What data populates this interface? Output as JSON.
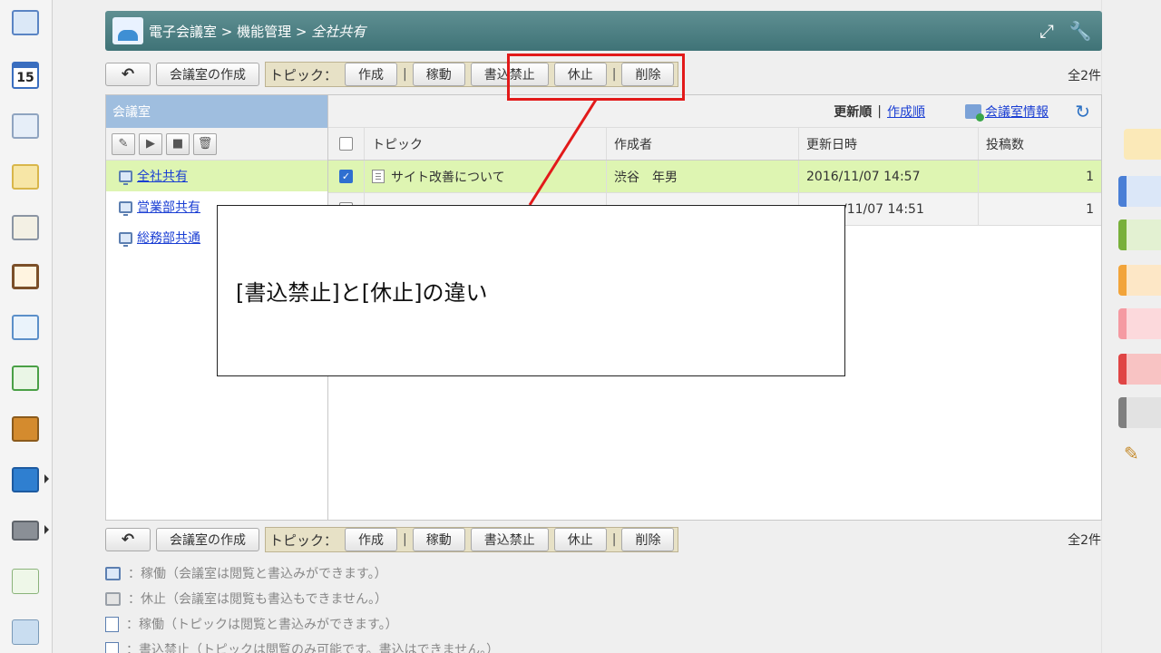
{
  "breadcrumb": {
    "root": "電子会議室",
    "sep1": " > ",
    "mid": "機能管理",
    "sep2": " > ",
    "current": "全社共有"
  },
  "toolbar": {
    "back_icon": "↶",
    "create_room": "会議室の作成",
    "topic_label": "トピック：",
    "create": "作成",
    "divider": "|",
    "activate": "稼動",
    "write_prohibit": "書込禁止",
    "suspend": "休止",
    "delete": "削除",
    "total": "全2件"
  },
  "rooms_panel": {
    "title": "会議室",
    "tools": [
      "edit-icon",
      "play-icon",
      "stop-icon",
      "trash-icon"
    ],
    "rooms": [
      {
        "name": "全社共有",
        "selected": true
      },
      {
        "name": "営業部共有",
        "selected": false
      },
      {
        "name": "総務部共通",
        "selected": false
      }
    ]
  },
  "sort": {
    "by_update": "更新順",
    "separator": "|",
    "by_create": "作成順",
    "room_info": "会議室情報"
  },
  "table": {
    "headers": [
      "トピック",
      "作成者",
      "更新日時",
      "投稿数"
    ],
    "rows": [
      {
        "topic": "サイト改善について",
        "author": "渋谷　年男",
        "updated": "2016/11/07 14:57",
        "posts": "1",
        "checked": true
      },
      {
        "topic": "",
        "author": "",
        "updated": "/11/07 14:51",
        "posts": "1",
        "checked": false
      }
    ]
  },
  "callout": {
    "text": "[書込禁止]と[休止]の違い"
  },
  "legend": [
    {
      "icon": "room-active-icon",
      "text": "：稼働（会議室は閲覧と書込みができます。）"
    },
    {
      "icon": "room-suspended-icon",
      "text": "：休止（会議室は閲覧も書込もできません。）"
    },
    {
      "icon": "topic-active-icon",
      "text": "：稼働（トピックは閲覧と書込みができます。）"
    },
    {
      "icon": "topic-readonly-icon",
      "text": "：書込禁止（トピックは閲覧のみ可能です。書込はできません。）"
    }
  ],
  "colors": {
    "header": "#4f8285",
    "selected_row": "#def5b2",
    "highlight_red": "#e21a1a",
    "link": "#1a3ed3"
  }
}
